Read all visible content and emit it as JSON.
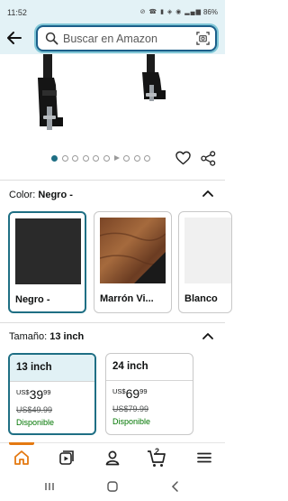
{
  "status_bar": {
    "time": "11:52",
    "icons": "⊘ ☎ ▮ ◈ ◉ ▂▄▆",
    "battery": "86%"
  },
  "header": {
    "search_placeholder": "Buscar en Amazon"
  },
  "carousel": {
    "dot_count": 11,
    "active_index": 0
  },
  "color": {
    "label": "Color:",
    "selected": "Negro -",
    "options": [
      {
        "label": "Negro -",
        "swatch": "#2a2a2a"
      },
      {
        "label": "Marrón Vi...",
        "swatch": "#8a5230"
      },
      {
        "label": "Blanco",
        "swatch": "#f0f0f0"
      }
    ]
  },
  "size": {
    "label": "Tamaño:",
    "selected": "13 inch",
    "options": [
      {
        "name": "13 inch",
        "currency": "US$",
        "whole": "39",
        "cents": "99",
        "list_price": "US$49.99",
        "availability": "Disponible"
      },
      {
        "name": "24 inch",
        "currency": "US$",
        "whole": "69",
        "cents": "99",
        "list_price": "US$79.99",
        "availability": "Disponible"
      }
    ]
  },
  "bottom_nav": {
    "cart_count": "2"
  },
  "colors": {
    "accent": "#1f6f84",
    "header_bg": "#e3f2f6",
    "nav_indicator": "#e47911",
    "available": "#007600"
  }
}
